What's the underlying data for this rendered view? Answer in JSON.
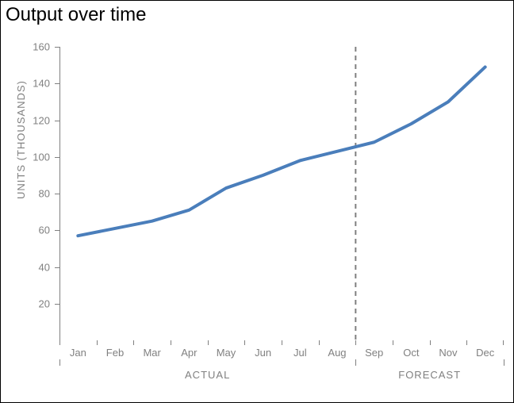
{
  "title": "Output over time",
  "ylabel": "UNITS (THOUSANDS)",
  "group_labels": {
    "actual": "ACTUAL",
    "forecast": "FORECAST"
  },
  "chart_data": {
    "type": "line",
    "title": "Output over time",
    "ylabel": "UNITS (THOUSANDS)",
    "xlabel": "",
    "ylim": [
      0,
      160
    ],
    "yticks": [
      20,
      40,
      60,
      80,
      100,
      120,
      140,
      160
    ],
    "categories": [
      "Jan",
      "Feb",
      "Mar",
      "Apr",
      "May",
      "Jun",
      "Jul",
      "Aug",
      "Sep",
      "Oct",
      "Nov",
      "Dec"
    ],
    "groups": [
      {
        "name": "ACTUAL",
        "categories": [
          "Jan",
          "Feb",
          "Mar",
          "Apr",
          "May",
          "Jun",
          "Jul",
          "Aug"
        ]
      },
      {
        "name": "FORECAST",
        "categories": [
          "Sep",
          "Oct",
          "Nov",
          "Dec"
        ]
      }
    ],
    "series": [
      {
        "name": "Output",
        "values": [
          57,
          61,
          65,
          71,
          83,
          90,
          98,
          103,
          108,
          118,
          130,
          149
        ]
      }
    ],
    "annotations": [
      {
        "type": "vline",
        "x": 8,
        "style": "dashed",
        "note": "boundary between Aug and Sep"
      }
    ],
    "line_color": "#4a7ebb"
  }
}
